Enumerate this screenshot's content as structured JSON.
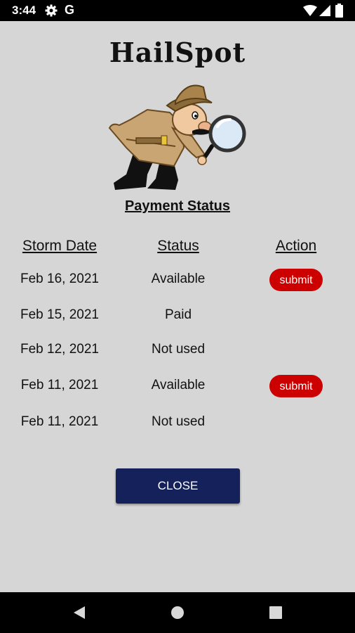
{
  "status_bar": {
    "time": "3:44",
    "icons": [
      "settings-gear-icon",
      "google-g-icon",
      "wifi-icon",
      "signal-icon",
      "battery-icon"
    ]
  },
  "app": {
    "title": "HailSpot",
    "mascot": "detective-with-magnifying-glass"
  },
  "payment": {
    "section_title": "Payment Status",
    "columns": [
      "Storm Date",
      "Status",
      "Action"
    ],
    "rows": [
      {
        "date": "Feb 16, 2021",
        "status": "Available",
        "action": "submit"
      },
      {
        "date": "Feb 15, 2021",
        "status": "Paid",
        "action": ""
      },
      {
        "date": "Feb 12, 2021",
        "status": "Not used",
        "action": ""
      },
      {
        "date": "Feb 11, 2021",
        "status": "Available",
        "action": "submit"
      },
      {
        "date": "Feb 11, 2021",
        "status": "Not used",
        "action": ""
      }
    ]
  },
  "close_label": "CLOSE",
  "colors": {
    "background": "#d6d6d6",
    "submit": "#cc0000",
    "close": "#14215a"
  },
  "nav_bar": [
    "back-icon",
    "home-icon",
    "recents-icon"
  ]
}
